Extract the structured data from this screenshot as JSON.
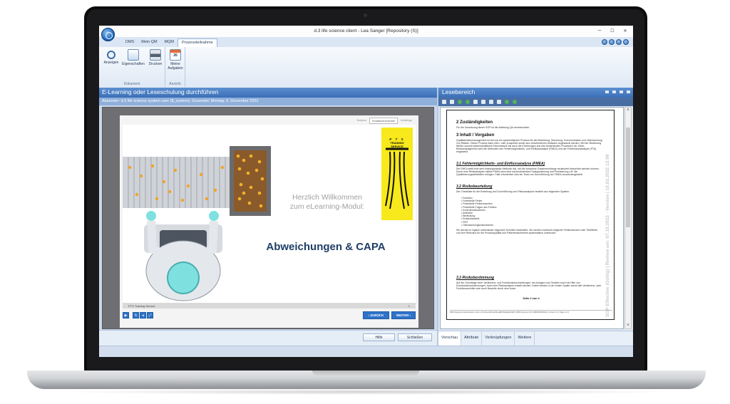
{
  "window": {
    "title": "d.3 life science client - Lea Sanger [Repository (S)]",
    "controls": {
      "minimize": "–",
      "maximize": "☐",
      "close": "✕"
    }
  },
  "ribbon": {
    "tabs": [
      "DMS",
      "Mein QM",
      "MQM",
      "Prozessteilnahme"
    ],
    "active_tab": "Prozessteilnahme",
    "groups": [
      {
        "caption": "Dokument",
        "buttons": [
          {
            "label": "Anzeigen",
            "icon": "magnifier-icon"
          },
          {
            "label": "Eigenschaften",
            "icon": "properties-icon"
          },
          {
            "label": "Drucken",
            "icon": "printer-icon"
          }
        ]
      },
      {
        "caption": "Ansicht",
        "buttons": [
          {
            "label": "Meine Aufgaben",
            "icon": "calendar-icon",
            "date": "26"
          }
        ]
      }
    ]
  },
  "left_panel": {
    "title": "E-Learning oder Leseschulung durchführen",
    "sender": "Absender: d.3 life science system user ($_system), Gesendet: Montag, 6. Dezember 2021",
    "course_tabs": [
      "Notizen",
      "Inhaltsverzeichnis",
      "Anhänge"
    ],
    "active_course_tab": "Inhaltsverzeichnis",
    "slide": {
      "welcome_line1": "Herzlich Willkommen",
      "welcome_line2": "zum eLearning-Modul:",
      "title": "Abweichungen & CAPA",
      "logo_text": "P T S\nTRAINING\nSERVICE"
    },
    "slide_footer": {
      "text": "PTS Training Service",
      "page": "1"
    },
    "controls": {
      "back": "‹ ZURÜCK",
      "next": "WEITER ›"
    },
    "footer_buttons": {
      "help": "Hilfe",
      "close": "Schließen"
    }
  },
  "right_panel": {
    "title": "Lesebereich",
    "document": {
      "sections": [
        {
          "heading": "2  Zuständigkeiten",
          "text": "Für die Umsetzung dieser SOP ist die Abteilung QA verantwortlich."
        },
        {
          "heading": "3  Inhalt / Vorgaben",
          "text": "Qualitätsrisikomanagement ist bei uns ein systematischer Prozess für die Bewertung, Steuerung, Kommunikation und Überwachung von Risiken. Dieser Prozess kann retro- oder prospektiv sowie aus verschiedenen Anlässen angewandt werden. Bei der Bewertung fließen sowohl wissenschaftliche Erkenntnisse als auch die Erfahrungen aus den bestehenden Prozessen ein. Beim Risikomanagement wird die Methoden der Fehlermöglichkeits- und Einflussanalyse (FMEA) und der Fehlerbaumanalyse (FTA) eingesetzt."
        },
        {
          "heading": "3.1  Fehlermöglichkeits- und Einflussanalyse (FMEA)",
          "text": "Die FMEA stellt eine sehr leistungsstarke Methode dar, mit der komplexe Zusammenhänge strukturiert betrachtet werden können. Durch eine Risikoanalyse mittels FMEA kann eine nachvollziehbare Kategorisierung und Priorisierung z.B. der Qualifizierungsaktivitäten erfolgen. Falls erforderlich wird ein Team zur Durchführung der FMEA zusammengestellt."
        },
        {
          "heading": "3.2  Risikobeurteilung",
          "text": "Die Checkliste für die Erstellung und Durchführung von Risikoanalysen besteht aus folgenden Spalten:"
        },
        {
          "heading": "3.3  Risikobestimmung",
          "text": "Auf der Grundlage einer Verfahrens- und Funktionsbeschreibungen, bei Anlagen und Geräten auch mit Hilfe von Konstruktionszeichnungen, kann eine Risikoanalyse erstellt werden. Dabei werden in der ersten Spalte zuerst alle Verfahrens- oder Funktionsschritte oder auch Bauteile durch eine kurze"
        }
      ],
      "bullets": [
        "Funktion",
        "Potentielle Fehler",
        "Potentielle Fehlerursachen",
        "Potentielle Folgen des Fehlers",
        "Kontrollmaßnahmen",
        "Auftreten",
        "Bedeutung",
        "Entdeckbarkeit",
        "RPZ",
        "Überwachungsmaßnahmen"
      ],
      "after_bullets": "Sie werden in logisch aufeinander folgenden Schritten bearbeitet. Sie werden eventuell mögliche Fehlfunktionen oder Teilefehler und ihre Relevanz für die Produktqualität und Patientensicherheit systematisch untersucht.",
      "page_label": "Seite 2 von 4",
      "footer": "DMS Signature Authentication Code: a712c0a-4a50-4e09-aa88-f9d4e9a1f1ab8 | DMS Document ID: (DMS000000414) | Version 1.0 | Page 1 of 4",
      "watermark": "SOP Effective (Gültig) | Review am: 07.10.2022 - Version | 10.03.2022 12:06"
    },
    "tabs": [
      "Vorschau",
      "Attribute",
      "Verknüpfungen",
      "Weitere"
    ],
    "active_tab": "Vorschau"
  }
}
